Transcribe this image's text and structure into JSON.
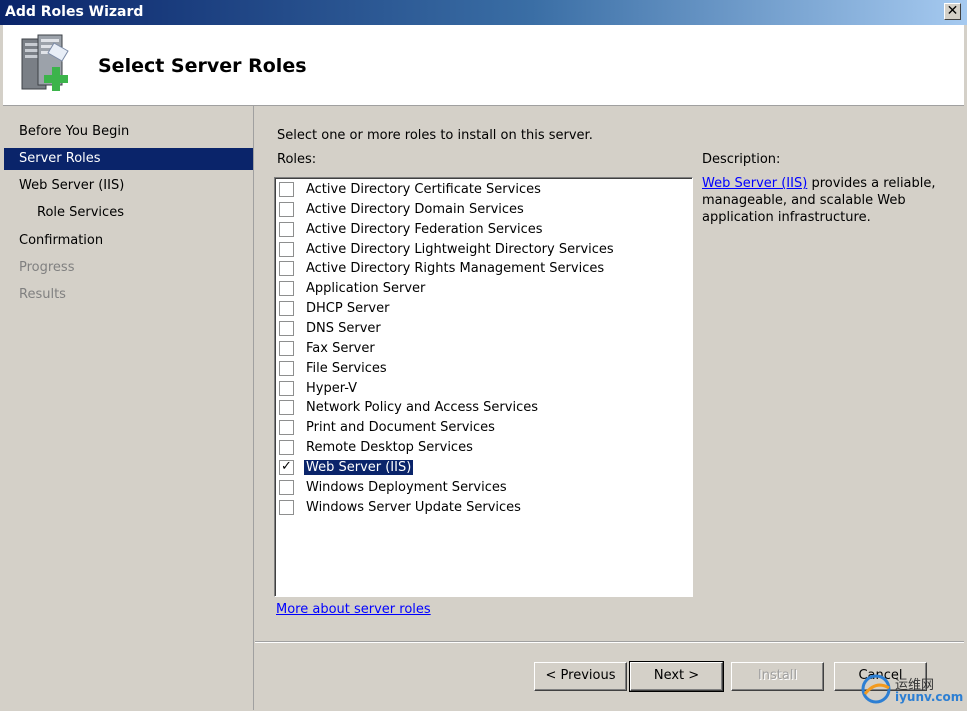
{
  "window": {
    "title": "Add Roles Wizard",
    "close_glyph": "✕"
  },
  "header": {
    "title": "Select Server Roles",
    "icon": "server-roles-icon"
  },
  "nav": {
    "items": [
      {
        "label": "Before You Begin",
        "state": "normal",
        "indent": false
      },
      {
        "label": "Server Roles",
        "state": "active",
        "indent": false
      },
      {
        "label": "Web Server (IIS)",
        "state": "normal",
        "indent": false
      },
      {
        "label": "Role Services",
        "state": "normal",
        "indent": true
      },
      {
        "label": "Confirmation",
        "state": "normal",
        "indent": false
      },
      {
        "label": "Progress",
        "state": "disabled",
        "indent": false
      },
      {
        "label": "Results",
        "state": "disabled",
        "indent": false
      }
    ]
  },
  "main": {
    "instruction": "Select one or more roles to install on this server.",
    "roles_label": "Roles:",
    "roles": [
      {
        "label": "Active Directory Certificate Services",
        "checked": false
      },
      {
        "label": "Active Directory Domain Services",
        "checked": false
      },
      {
        "label": "Active Directory Federation Services",
        "checked": false
      },
      {
        "label": "Active Directory Lightweight Directory Services",
        "checked": false
      },
      {
        "label": "Active Directory Rights Management Services",
        "checked": false
      },
      {
        "label": "Application Server",
        "checked": false
      },
      {
        "label": "DHCP Server",
        "checked": false
      },
      {
        "label": "DNS Server",
        "checked": false
      },
      {
        "label": "Fax Server",
        "checked": false
      },
      {
        "label": "File Services",
        "checked": false
      },
      {
        "label": "Hyper-V",
        "checked": false
      },
      {
        "label": "Network Policy and Access Services",
        "checked": false
      },
      {
        "label": "Print and Document Services",
        "checked": false
      },
      {
        "label": "Remote Desktop Services",
        "checked": false
      },
      {
        "label": "Web Server (IIS)",
        "checked": true,
        "selected": true
      },
      {
        "label": "Windows Deployment Services",
        "checked": false
      },
      {
        "label": "Windows Server Update Services",
        "checked": false
      }
    ],
    "description_label": "Description:",
    "description_link": "Web Server (IIS)",
    "description_text": " provides a reliable, manageable, and scalable Web application infrastructure.",
    "more_link": "More about server roles"
  },
  "footer": {
    "previous_label": "< Previous",
    "next_label": "Next >",
    "install_label": "Install",
    "cancel_label": "Cancel"
  },
  "watermark": {
    "line1": "运维网",
    "line2": "iyunv.com"
  },
  "colors": {
    "accent": "#0a246a",
    "link": "#0000ff",
    "face": "#d4d0c8"
  }
}
